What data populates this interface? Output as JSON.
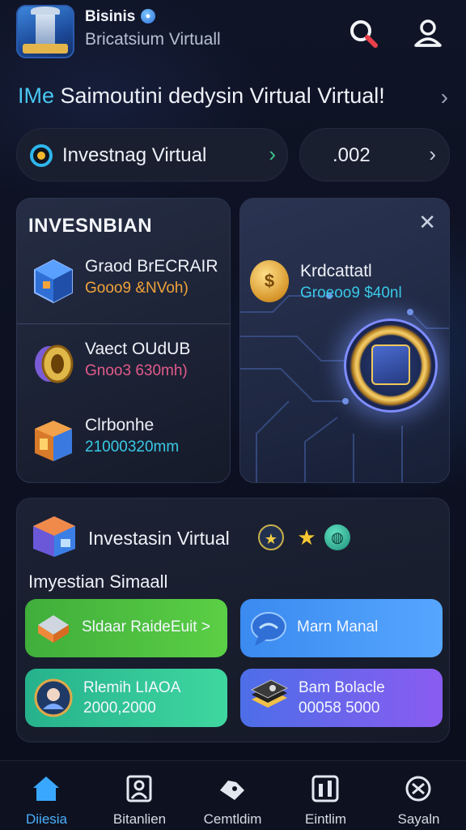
{
  "header": {
    "app_name": "Bisinis",
    "subtitle": "Bricatsium Virtuall"
  },
  "banner": {
    "accent_text": "IMe",
    "text": " Saimoutini dedysin Virtual Virtual!"
  },
  "pills": {
    "left_label": "Investnag Virtual",
    "right_value": ".002"
  },
  "left_card": {
    "title": "INVESNBIAN",
    "items": [
      {
        "title": "Graod BrECRAIR",
        "subtitle": "Gooo9 &NVoh)",
        "subtitle_color": "#f0a33a"
      },
      {
        "title": "Vaect OUdUB",
        "subtitle": "Gnoo3 630mh)",
        "subtitle_color": "#e35a8b"
      },
      {
        "title": "Clrbonhe",
        "subtitle": "21000320mm",
        "subtitle_color": "#39c9e6"
      }
    ]
  },
  "right_card": {
    "coin_symbol": "$",
    "title": "Krdcattatl",
    "subtitle": "Groeoo9 $40nl"
  },
  "panel": {
    "title": "Investasin Virtual",
    "subtitle": "Imyestian Simaall",
    "badge_star": "★",
    "tiles": [
      {
        "label": "Sldaar RaideEuit >"
      },
      {
        "label": "Marn Manal"
      },
      {
        "line1": "Rlemih LIAOA",
        "line2": "2000,2000"
      },
      {
        "line1": "Bam Bolacle",
        "line2": "00058 5000"
      }
    ]
  },
  "nav": {
    "items": [
      {
        "label": "Diiesia",
        "icon": "home-icon",
        "active": true
      },
      {
        "label": "Bitanlien",
        "icon": "person-board-icon",
        "active": false
      },
      {
        "label": "Cemtldim",
        "icon": "handshake-icon",
        "active": false
      },
      {
        "label": "Eintlim",
        "icon": "chart-box-icon",
        "active": false
      },
      {
        "label": "Sayaln",
        "icon": "settings-icon",
        "active": false
      }
    ]
  },
  "colors": {
    "accent": "#49c7f2",
    "active_nav": "#4bb0ff",
    "background": "#0d1120"
  }
}
